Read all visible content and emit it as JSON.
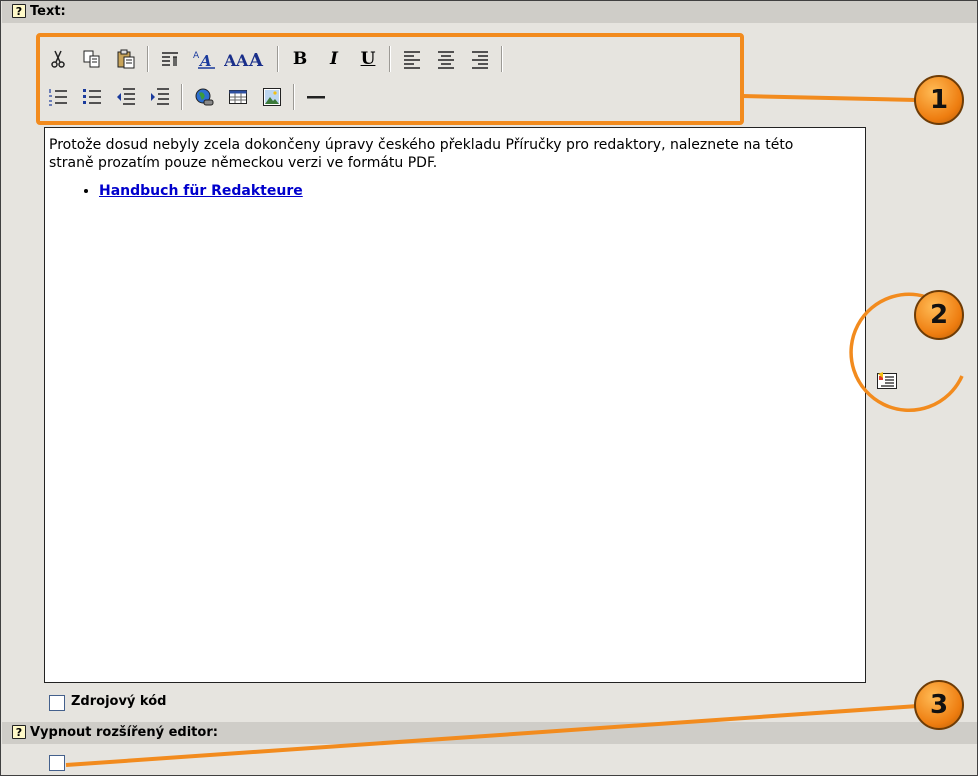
{
  "sections": {
    "text": {
      "help": "?",
      "label": "Text:"
    },
    "extended": {
      "help": "?",
      "label": "Vypnout rozšířený editor:"
    }
  },
  "toolbar": {
    "row1": [
      "cut-icon",
      "copy-icon",
      "paste-icon",
      "format-block-icon",
      "font-color-icon",
      "font-size-icon",
      "bold-icon",
      "italic-icon",
      "underline-icon",
      "align-left-icon",
      "align-center-icon",
      "align-right-icon"
    ],
    "row2": [
      "ordered-list-icon",
      "unordered-list-icon",
      "outdent-icon",
      "indent-icon",
      "insert-link-icon",
      "insert-table-icon",
      "insert-image-icon",
      "horizontal-rule-icon"
    ],
    "bold": "B",
    "italic": "I",
    "underline": "U"
  },
  "editor": {
    "paragraph": "Protože dosud nebyly zcela dokončeny úpravy českého překladu Příručky pro redaktory, naleznete na této straně prozatím pouze německou verzi ve formátu PDF.",
    "link": "Handbuch für Redakteure"
  },
  "source_code": {
    "label": "Zdrojový kód",
    "checked": false
  },
  "extended_editor": {
    "checked": false
  },
  "callouts": {
    "one": "1",
    "two": "2",
    "three": "3"
  },
  "colors": {
    "callout": "#f28b1e",
    "header": "#cfcdc8",
    "panel": "#e6e4df",
    "link": "#0000cc"
  }
}
